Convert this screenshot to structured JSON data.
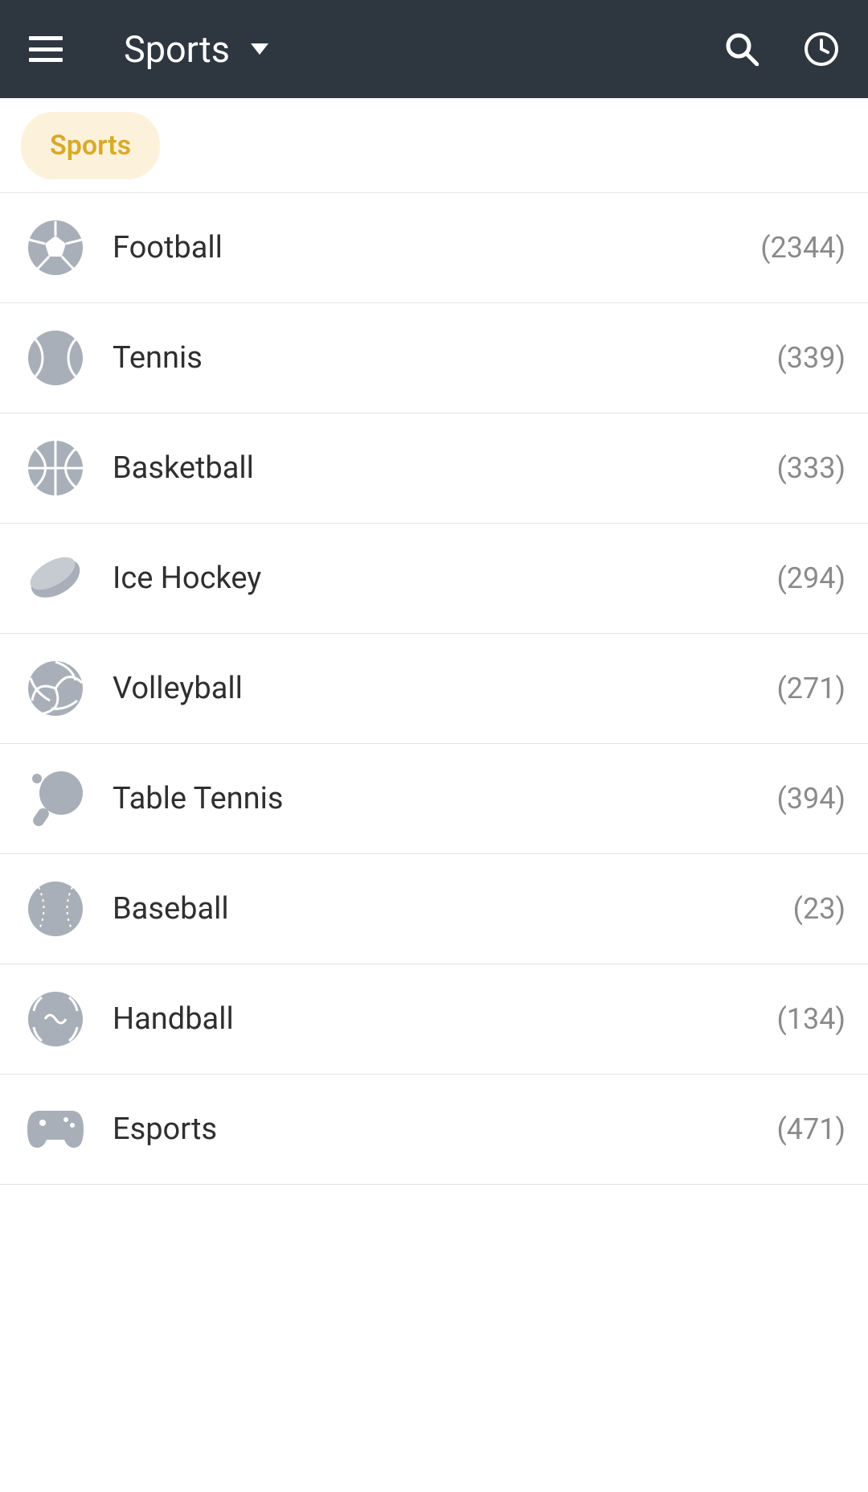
{
  "header": {
    "title": "Sports"
  },
  "chip": {
    "label": "Sports"
  },
  "sports": [
    {
      "label": "Football",
      "count": "(2344)",
      "icon": "football"
    },
    {
      "label": "Tennis",
      "count": "(339)",
      "icon": "tennis"
    },
    {
      "label": "Basketball",
      "count": "(333)",
      "icon": "basketball"
    },
    {
      "label": "Ice Hockey",
      "count": "(294)",
      "icon": "icehockey"
    },
    {
      "label": "Volleyball",
      "count": "(271)",
      "icon": "volleyball"
    },
    {
      "label": "Table Tennis",
      "count": "(394)",
      "icon": "tabletennis"
    },
    {
      "label": "Baseball",
      "count": "(23)",
      "icon": "baseball"
    },
    {
      "label": "Handball",
      "count": "(134)",
      "icon": "handball"
    },
    {
      "label": "Esports",
      "count": "(471)",
      "icon": "esports"
    }
  ]
}
